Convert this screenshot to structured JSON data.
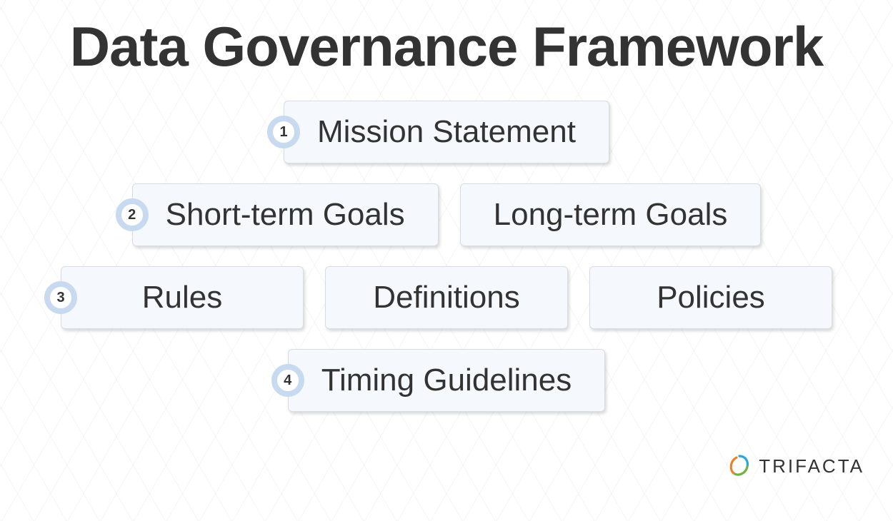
{
  "title": "Data Governance Framework",
  "rows": [
    {
      "badge": "1",
      "items": [
        "Mission Statement"
      ]
    },
    {
      "badge": "2",
      "items": [
        "Short-term Goals",
        "Long-term Goals"
      ]
    },
    {
      "badge": "3",
      "items": [
        "Rules",
        "Definitions",
        "Policies"
      ]
    },
    {
      "badge": "4",
      "items": [
        "Timing Guidelines"
      ]
    }
  ],
  "brand": {
    "name": "TRIFACTA"
  }
}
